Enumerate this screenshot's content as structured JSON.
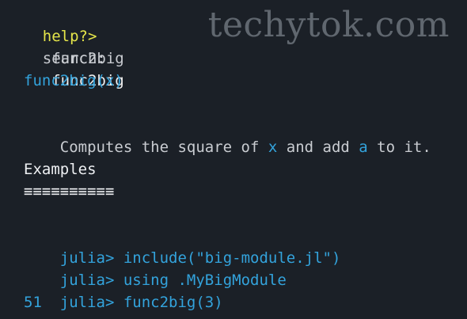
{
  "watermark": "techytok.com",
  "prompt": {
    "label": "help?>",
    "input": "func2big"
  },
  "search": {
    "label": "search:",
    "query": "func2big"
  },
  "doc": {
    "signature": "func2big(x)",
    "description": {
      "part1": "Computes the square of ",
      "arg1": "x",
      "part2": " and add ",
      "arg2": "a",
      "part3": " to it."
    },
    "examples_heading": "Examples",
    "examples_underline": "≡≡≡≡≡≡≡≡≡≡",
    "code_lines": [
      {
        "prompt": "julia>",
        "code": "include(\"big-module.jl\")"
      },
      {
        "prompt": "julia>",
        "code": "using .MyBigModule"
      },
      {
        "prompt": "julia>",
        "code": "func2big(3)"
      }
    ],
    "result": "51"
  },
  "colors": {
    "background": "#1b2027",
    "prompt_yellow": "#e5e54a",
    "code_blue": "#33a3dc",
    "text_grey": "#c9ccd1"
  }
}
